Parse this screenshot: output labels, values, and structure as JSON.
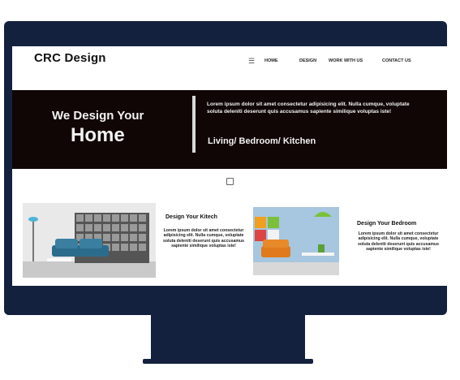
{
  "site": {
    "logo": "CRC  Design",
    "menu_icon": "hamburger-menu-icon",
    "nav_links": [
      "HOME",
      "DESIGN",
      "WORK WITH US",
      "CONTACT US"
    ]
  },
  "hero": {
    "line1": "We Design Your",
    "line2": "Home",
    "body_text": "Lorem ipsum dolor sit amet consectetur adipisicing elit. Nulla cumque, voluptate soluta deleniti deserunt quis accusamus sapiente similique voluptas iste!",
    "sub": "Living/ Bedroom/ Kitchen"
  },
  "cards": [
    {
      "title": "Design Your Kitech",
      "text": "Lorem ipsum dolor sit amet consectetur adipisicing elit. Nulla cumque, voluptate soluta deleniti deserunt quis accusamus sapiente similique voluptas iste!"
    },
    {
      "title": "Design Your Bedroom",
      "text": "Lorem ipsum dolor sit amet consectetur adipisicing elit. Nulla cumque, voluptate soluta deleniti deserunt quis accusamus sapiente similique voluptas iste!"
    }
  ],
  "colors": {
    "monitor": "#13213f",
    "hero_bg": "#110606",
    "hero_text": "#f2f2f2"
  }
}
